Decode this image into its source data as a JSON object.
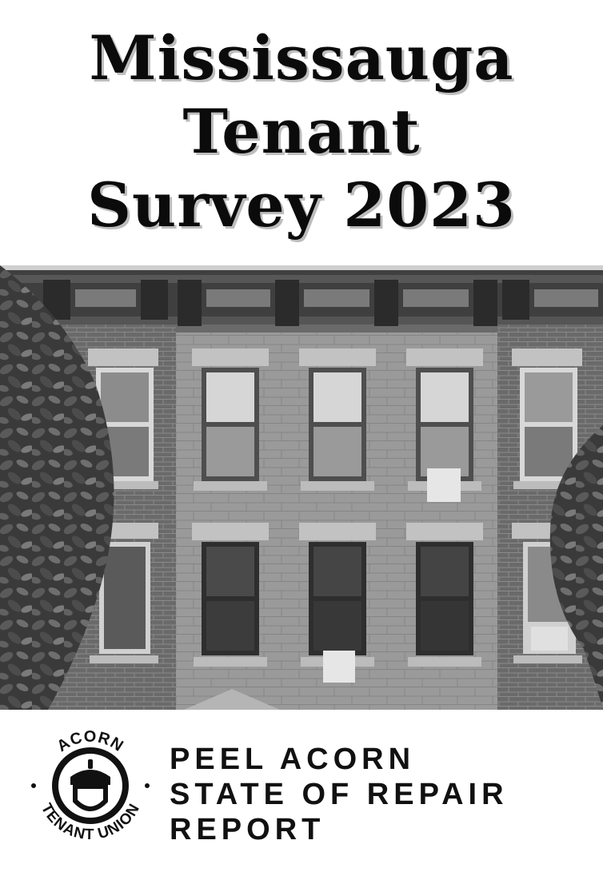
{
  "cover": {
    "title_lines": [
      "Mississauga",
      "Tenant",
      "Survey 2023"
    ]
  },
  "logo": {
    "top_text": "ACORN",
    "bottom_text": "TENANT UNION"
  },
  "report": {
    "lines": [
      "PEEL ACORN",
      "STATE OF REPAIR",
      "REPORT"
    ]
  }
}
